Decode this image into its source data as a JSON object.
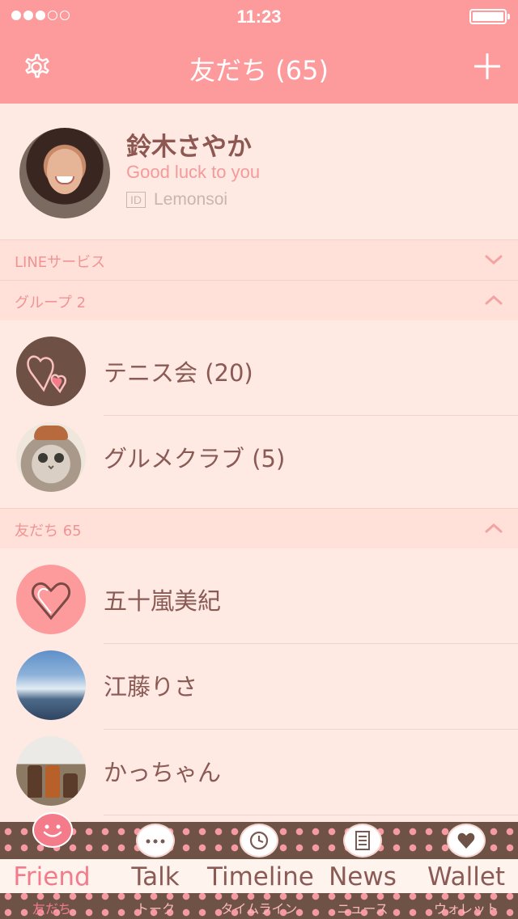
{
  "status_bar": {
    "time": "11:23",
    "signal_bars_filled": 3,
    "signal_bars_total": 5
  },
  "nav": {
    "title": "友だち (65)",
    "settings_icon": "gear-icon",
    "add_icon": "plus-icon"
  },
  "profile": {
    "name": "鈴木さやか",
    "status_message": "Good luck to you",
    "id_badge": "ID",
    "id_value": "Lemonsoi"
  },
  "sections": {
    "line_services": {
      "label": "LINEサービス",
      "expanded": false
    },
    "groups": {
      "label": "グループ 2",
      "expanded": true
    },
    "friends": {
      "label": "友だち 65",
      "expanded": true
    }
  },
  "groups": [
    {
      "name": "テニス会 (20)",
      "avatar": "heart-brown"
    },
    {
      "name": "グルメクラブ (5)",
      "avatar": "cat-photo"
    }
  ],
  "friends": [
    {
      "name": "五十嵐美紀",
      "avatar": "heart-pink"
    },
    {
      "name": "江藤りさ",
      "avatar": "sky-photo"
    },
    {
      "name": "かっちゃん",
      "avatar": "jars-photo"
    }
  ],
  "tabs": [
    {
      "label": "Friend",
      "sub": "友だち",
      "icon": "smile-icon",
      "active": true
    },
    {
      "label": "Talk",
      "sub": "トーク",
      "icon": "chat-bubble-icon",
      "active": false
    },
    {
      "label": "Timeline",
      "sub": "タイムライン",
      "icon": "clock-icon",
      "active": false
    },
    {
      "label": "News",
      "sub": "ニュース",
      "icon": "news-icon",
      "active": false
    },
    {
      "label": "Wallet",
      "sub": "ウォレット",
      "icon": "heart-wallet-icon",
      "active": false
    }
  ],
  "colors": {
    "header": "#fd9a9c",
    "background": "#ffe9e3",
    "accent": "#f47c8a",
    "text": "#8a5a55"
  }
}
